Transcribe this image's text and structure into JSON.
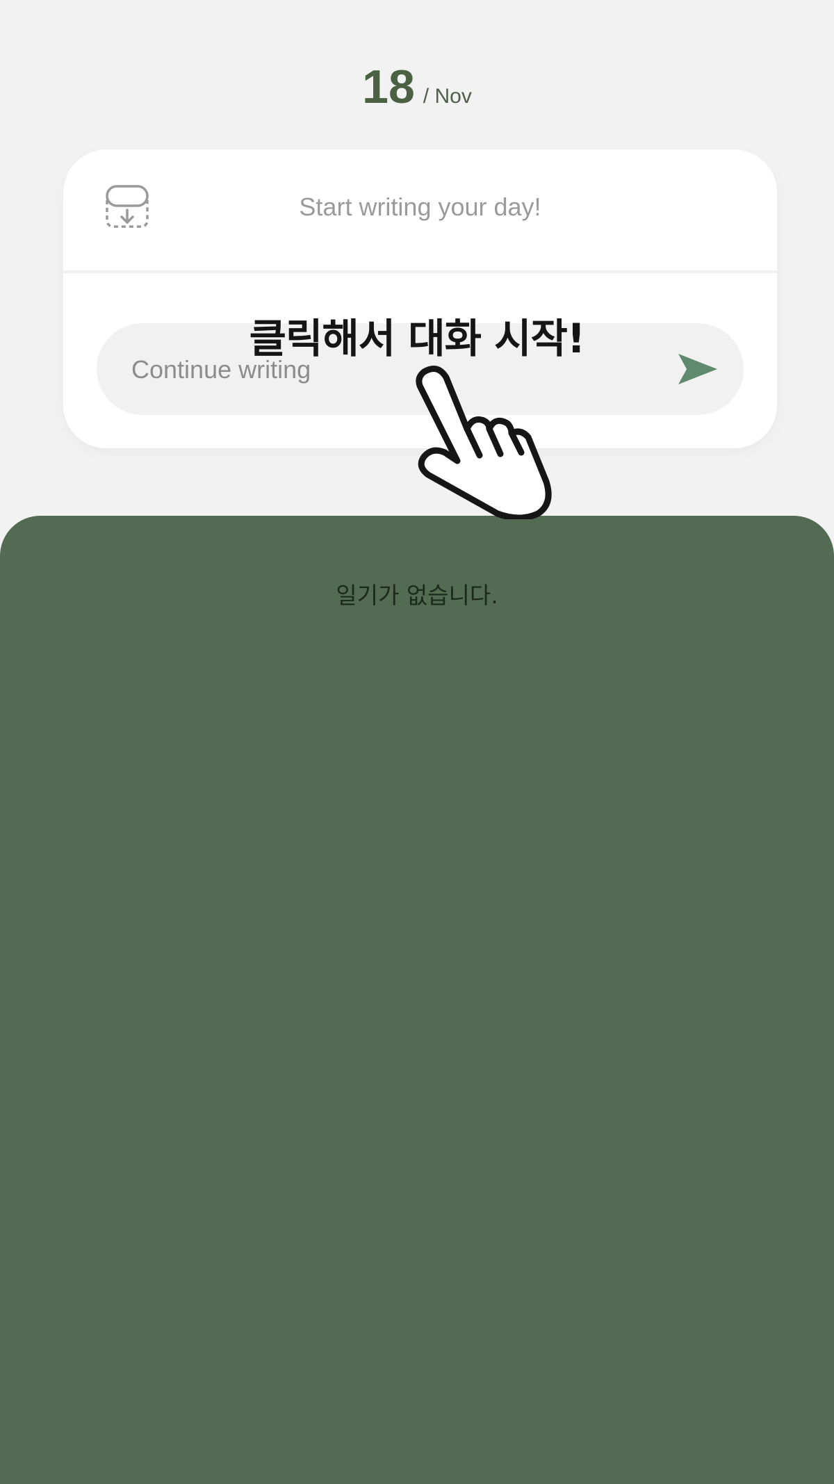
{
  "date": {
    "day": "18",
    "month": "/ Nov"
  },
  "card": {
    "prompt": "Start writing your day!",
    "sticker_icon": "sticker-download-icon",
    "input_placeholder": "Continue writing",
    "input_value": "",
    "send_icon": "send-icon"
  },
  "overlay": {
    "caption": "클릭해서 대화 시작!",
    "hand_icon": "pointing-hand-icon"
  },
  "diary": {
    "empty_message": "일기가 없습니다."
  },
  "colors": {
    "background": "#f2f2f2",
    "accent": "#4a6143",
    "panel": "#526b52",
    "send": "#5f8a6e"
  }
}
